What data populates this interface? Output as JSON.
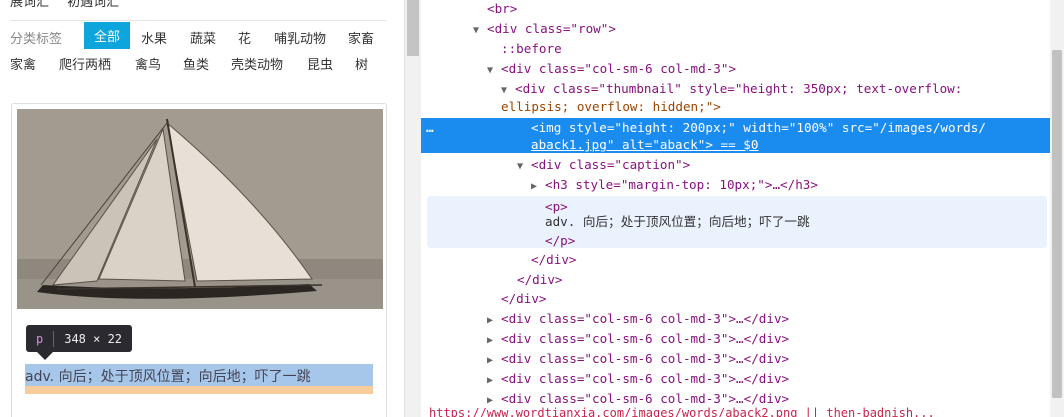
{
  "page": {
    "top_links": [
      "展词汇",
      "初遇词汇"
    ],
    "tag_label": "分类标签",
    "tags_row1": [
      "全部",
      "水果",
      "蔬菜",
      "花",
      "哺乳动物",
      "家畜"
    ],
    "tags_row2": [
      "家禽",
      "爬行两栖",
      "禽鸟",
      "鱼类",
      "壳类动物",
      "昆虫",
      "树"
    ],
    "active_tag": "全部",
    "card_image_alt": "aback",
    "highlighted_text": "adv. 向后；处于顶风位置；向后地；吓了一跳"
  },
  "tooltip": {
    "tag": "p",
    "size": "348 × 22"
  },
  "devtools": {
    "lines": {
      "br": "<br>",
      "row_open": "<div class=\"row\">",
      "before": "::before",
      "col_open": "<div class=\"col-sm-6 col-md-3\">",
      "thumb_1": "<div class=\"thumbnail\" style=\"height: 350px; text-overflow:",
      "thumb_2": "ellipsis; overflow: hidden;\">",
      "img_1": "<img style=\"height: 200px;\" width=\"100%\" src=\"/images/words/",
      "img_2": "aback1.jpg\" alt=\"aback\"> == $0",
      "caption_open": "<div class=\"caption\">",
      "h3": "<h3 style=\"margin-top: 10px;\">…</h3>",
      "p_open": "<p>",
      "p_text": "adv. 向后；处于顶风位置；向后地；吓了一跳",
      "p_close": "</p>",
      "div_close_1": "</div>",
      "div_close_2": "</div>",
      "div_close_3": "</div>",
      "collapsed_col": "<div class=\"col-sm-6 col-md-3\">…</div>"
    },
    "ellipsis": "…",
    "bottom_text": "https://www.wordtianxia.com/images/words/aback2.png || then-badnish..."
  },
  "colors": {
    "active_tag_bg": "#0ea5dd",
    "selected_row": "#1a8cef",
    "tag_name": "#881280",
    "attr_name": "#994500",
    "attr_value": "#1a1aa6"
  },
  "icons": [
    "expand-triangle-icon",
    "collapse-triangle-icon",
    "sailboat-photo"
  ]
}
